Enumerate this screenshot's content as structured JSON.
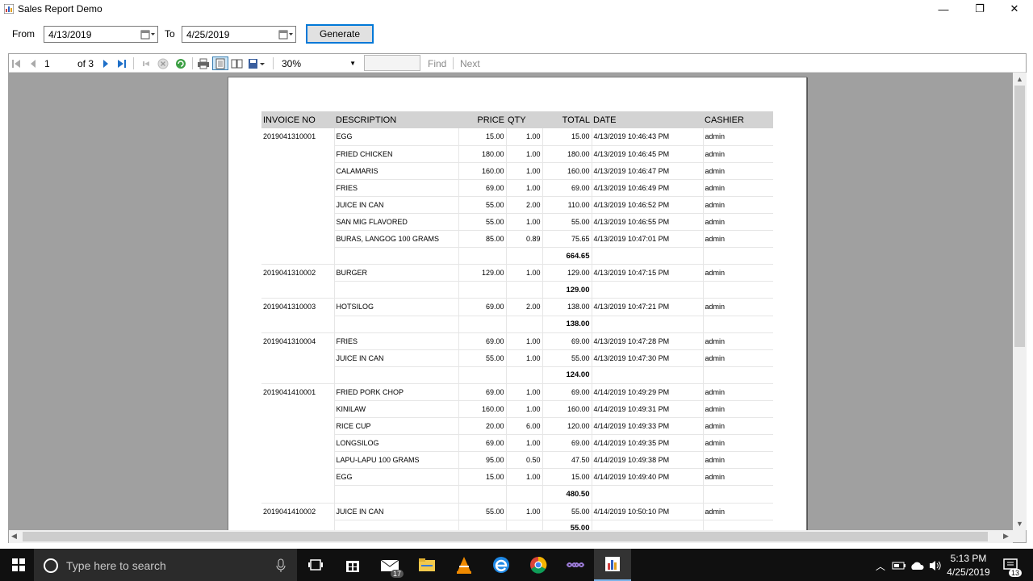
{
  "window": {
    "title": "Sales Report Demo",
    "minimize": "—",
    "restore": "❐",
    "close": "✕"
  },
  "filter": {
    "from_label": "From",
    "from_value": "4/13/2019",
    "to_label": "To",
    "to_value": "4/25/2019",
    "generate_label": "Generate"
  },
  "toolbar": {
    "page_current": "1",
    "page_of": "of 3",
    "zoom": "30%",
    "find_value": "",
    "find_label": "Find",
    "next_label": "Next"
  },
  "report": {
    "columns": [
      "INVOICE NO",
      "DESCRIPTION",
      "PRICE",
      "QTY",
      "TOTAL",
      "DATE",
      "CASHIER"
    ],
    "groups": [
      {
        "invoice": "2019041310001",
        "rows": [
          [
            "EGG",
            "15.00",
            "1.00",
            "15.00",
            "4/13/2019 10:46:43 PM",
            "admin"
          ],
          [
            "FRIED CHICKEN",
            "180.00",
            "1.00",
            "180.00",
            "4/13/2019 10:46:45 PM",
            "admin"
          ],
          [
            "CALAMARIS",
            "160.00",
            "1.00",
            "160.00",
            "4/13/2019 10:46:47 PM",
            "admin"
          ],
          [
            "FRIES",
            "69.00",
            "1.00",
            "69.00",
            "4/13/2019 10:46:49 PM",
            "admin"
          ],
          [
            "JUICE IN CAN",
            "55.00",
            "2.00",
            "110.00",
            "4/13/2019 10:46:52 PM",
            "admin"
          ],
          [
            "SAN MIG FLAVORED",
            "55.00",
            "1.00",
            "55.00",
            "4/13/2019 10:46:55 PM",
            "admin"
          ],
          [
            "BURAS, LANGOG 100 GRAMS",
            "85.00",
            "0.89",
            "75.65",
            "4/13/2019 10:47:01 PM",
            "admin"
          ]
        ],
        "total": "664.65"
      },
      {
        "invoice": "2019041310002",
        "rows": [
          [
            "BURGER",
            "129.00",
            "1.00",
            "129.00",
            "4/13/2019 10:47:15 PM",
            "admin"
          ]
        ],
        "total": "129.00"
      },
      {
        "invoice": "2019041310003",
        "rows": [
          [
            "HOTSILOG",
            "69.00",
            "2.00",
            "138.00",
            "4/13/2019 10:47:21 PM",
            "admin"
          ]
        ],
        "total": "138.00"
      },
      {
        "invoice": "2019041310004",
        "rows": [
          [
            "FRIES",
            "69.00",
            "1.00",
            "69.00",
            "4/13/2019 10:47:28 PM",
            "admin"
          ],
          [
            "JUICE IN CAN",
            "55.00",
            "1.00",
            "55.00",
            "4/13/2019 10:47:30 PM",
            "admin"
          ]
        ],
        "total": "124.00"
      },
      {
        "invoice": "2019041410001",
        "rows": [
          [
            "FRIED PORK CHOP",
            "69.00",
            "1.00",
            "69.00",
            "4/14/2019 10:49:29 PM",
            "admin"
          ],
          [
            "KINILAW",
            "160.00",
            "1.00",
            "160.00",
            "4/14/2019 10:49:31 PM",
            "admin"
          ],
          [
            "RICE CUP",
            "20.00",
            "6.00",
            "120.00",
            "4/14/2019 10:49:33 PM",
            "admin"
          ],
          [
            "LONGSILOG",
            "69.00",
            "1.00",
            "69.00",
            "4/14/2019 10:49:35 PM",
            "admin"
          ],
          [
            "LAPU-LAPU 100 GRAMS",
            "95.00",
            "0.50",
            "47.50",
            "4/14/2019 10:49:38 PM",
            "admin"
          ],
          [
            "EGG",
            "15.00",
            "1.00",
            "15.00",
            "4/14/2019 10:49:40 PM",
            "admin"
          ]
        ],
        "total": "480.50"
      },
      {
        "invoice": "2019041410002",
        "rows": [
          [
            "JUICE IN CAN",
            "55.00",
            "1.00",
            "55.00",
            "4/14/2019 10:50:10 PM",
            "admin"
          ]
        ],
        "total": "55.00"
      }
    ]
  },
  "taskbar": {
    "search_placeholder": "Type here to search",
    "mail_badge": "17",
    "time": "5:13 PM",
    "date": "4/25/2019",
    "notification_count": "13"
  }
}
